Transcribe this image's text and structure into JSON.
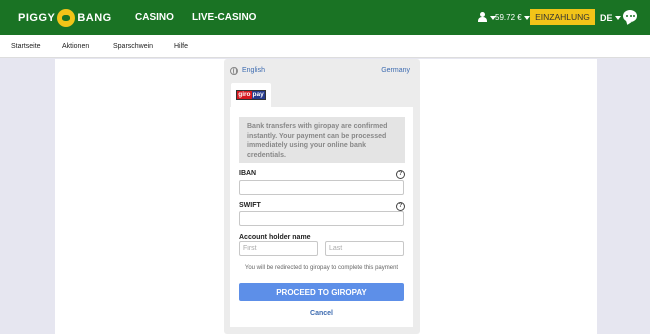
{
  "header": {
    "logo_left": "PIGGY",
    "logo_right": "BANG",
    "nav": [
      "CASINO",
      "LIVE-CASINO"
    ],
    "balance": "59.72 €",
    "deposit_label": "EINZAHLUNG",
    "language": "DE",
    "brand_color": "#1a7324",
    "deposit_color": "#f2c418"
  },
  "subnav": {
    "items": [
      "Startseite",
      "Aktionen",
      "Sparschwein",
      "Hilfe"
    ]
  },
  "payment": {
    "language": "English",
    "country": "Germany",
    "method_logo": {
      "part1": "giro",
      "part2": "pay"
    },
    "info_text": "Bank transfers with giropay are confirmed instantly. Your payment can be processed immediately using your online bank credentials.",
    "iban_label": "IBAN",
    "iban_value": "",
    "swift_label": "SWIFT",
    "swift_value": "",
    "holder_label": "Account holder name",
    "first_placeholder": "First",
    "last_placeholder": "Last",
    "help_symbol": "?",
    "redirect_note": "You will be redirected to giropay to complete this payment",
    "proceed_label": "PROCEED TO GIROPAY",
    "cancel_label": "Cancel",
    "button_color": "#5d8fe8"
  }
}
